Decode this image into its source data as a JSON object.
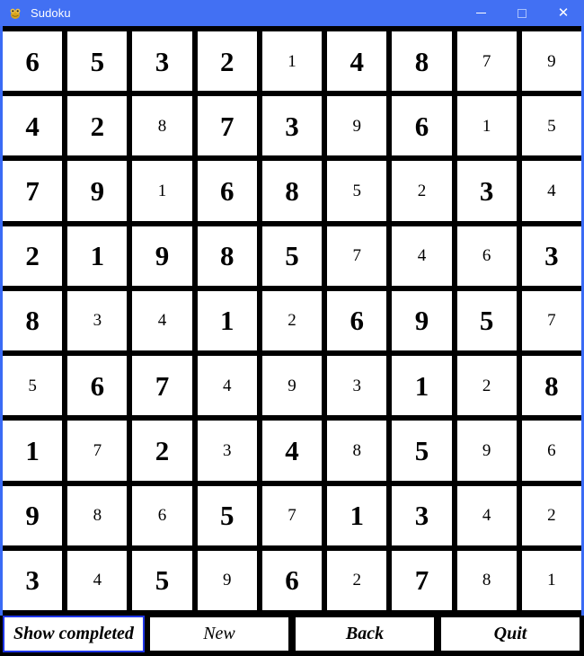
{
  "window": {
    "title": "Sudoku",
    "icon": "sudoku-app-icon",
    "accent_color": "#4270f3",
    "controls": [
      {
        "name": "minimize",
        "glyph": "minimize-icon"
      },
      {
        "name": "maximize",
        "glyph": "maximize-icon"
      },
      {
        "name": "close",
        "glyph": "close-icon"
      }
    ]
  },
  "board": {
    "rows": 9,
    "cols": 9,
    "cells": [
      [
        {
          "value": "6",
          "style": "bold"
        },
        {
          "value": "5",
          "style": "bold"
        },
        {
          "value": "3",
          "style": "bold"
        },
        {
          "value": "2",
          "style": "bold"
        },
        {
          "value": "1",
          "style": "thin"
        },
        {
          "value": "4",
          "style": "bold"
        },
        {
          "value": "8",
          "style": "bold"
        },
        {
          "value": "7",
          "style": "thin"
        },
        {
          "value": "9",
          "style": "thin"
        }
      ],
      [
        {
          "value": "4",
          "style": "bold"
        },
        {
          "value": "2",
          "style": "bold"
        },
        {
          "value": "8",
          "style": "thin"
        },
        {
          "value": "7",
          "style": "bold"
        },
        {
          "value": "3",
          "style": "bold"
        },
        {
          "value": "9",
          "style": "thin"
        },
        {
          "value": "6",
          "style": "bold"
        },
        {
          "value": "1",
          "style": "thin"
        },
        {
          "value": "5",
          "style": "thin"
        }
      ],
      [
        {
          "value": "7",
          "style": "bold"
        },
        {
          "value": "9",
          "style": "bold"
        },
        {
          "value": "1",
          "style": "thin"
        },
        {
          "value": "6",
          "style": "bold"
        },
        {
          "value": "8",
          "style": "bold"
        },
        {
          "value": "5",
          "style": "thin"
        },
        {
          "value": "2",
          "style": "thin"
        },
        {
          "value": "3",
          "style": "bold"
        },
        {
          "value": "4",
          "style": "thin"
        }
      ],
      [
        {
          "value": "2",
          "style": "bold"
        },
        {
          "value": "1",
          "style": "bold"
        },
        {
          "value": "9",
          "style": "bold"
        },
        {
          "value": "8",
          "style": "bold"
        },
        {
          "value": "5",
          "style": "bold"
        },
        {
          "value": "7",
          "style": "thin"
        },
        {
          "value": "4",
          "style": "thin"
        },
        {
          "value": "6",
          "style": "thin"
        },
        {
          "value": "3",
          "style": "bold"
        }
      ],
      [
        {
          "value": "8",
          "style": "bold"
        },
        {
          "value": "3",
          "style": "thin"
        },
        {
          "value": "4",
          "style": "thin"
        },
        {
          "value": "1",
          "style": "bold"
        },
        {
          "value": "2",
          "style": "thin"
        },
        {
          "value": "6",
          "style": "bold"
        },
        {
          "value": "9",
          "style": "bold"
        },
        {
          "value": "5",
          "style": "bold"
        },
        {
          "value": "7",
          "style": "thin"
        }
      ],
      [
        {
          "value": "5",
          "style": "thin"
        },
        {
          "value": "6",
          "style": "bold"
        },
        {
          "value": "7",
          "style": "bold"
        },
        {
          "value": "4",
          "style": "thin"
        },
        {
          "value": "9",
          "style": "thin"
        },
        {
          "value": "3",
          "style": "thin"
        },
        {
          "value": "1",
          "style": "bold"
        },
        {
          "value": "2",
          "style": "thin"
        },
        {
          "value": "8",
          "style": "bold"
        }
      ],
      [
        {
          "value": "1",
          "style": "bold"
        },
        {
          "value": "7",
          "style": "thin"
        },
        {
          "value": "2",
          "style": "bold"
        },
        {
          "value": "3",
          "style": "thin"
        },
        {
          "value": "4",
          "style": "bold"
        },
        {
          "value": "8",
          "style": "thin"
        },
        {
          "value": "5",
          "style": "bold"
        },
        {
          "value": "9",
          "style": "thin"
        },
        {
          "value": "6",
          "style": "thin"
        }
      ],
      [
        {
          "value": "9",
          "style": "bold"
        },
        {
          "value": "8",
          "style": "thin"
        },
        {
          "value": "6",
          "style": "thin"
        },
        {
          "value": "5",
          "style": "bold"
        },
        {
          "value": "7",
          "style": "thin"
        },
        {
          "value": "1",
          "style": "bold"
        },
        {
          "value": "3",
          "style": "bold"
        },
        {
          "value": "4",
          "style": "thin"
        },
        {
          "value": "2",
          "style": "thin"
        }
      ],
      [
        {
          "value": "3",
          "style": "bold"
        },
        {
          "value": "4",
          "style": "thin"
        },
        {
          "value": "5",
          "style": "bold"
        },
        {
          "value": "9",
          "style": "thin"
        },
        {
          "value": "6",
          "style": "bold"
        },
        {
          "value": "2",
          "style": "thin"
        },
        {
          "value": "7",
          "style": "bold"
        },
        {
          "value": "8",
          "style": "thin"
        },
        {
          "value": "1",
          "style": "thin"
        }
      ]
    ]
  },
  "buttons": [
    {
      "label": "Show completed",
      "name": "show-completed-button",
      "focused": true,
      "weight": "bold"
    },
    {
      "label": "New",
      "name": "new-button",
      "focused": false,
      "weight": "regular"
    },
    {
      "label": "Back",
      "name": "back-button",
      "focused": false,
      "weight": "bold"
    },
    {
      "label": "Quit",
      "name": "quit-button",
      "focused": false,
      "weight": "bold"
    }
  ]
}
